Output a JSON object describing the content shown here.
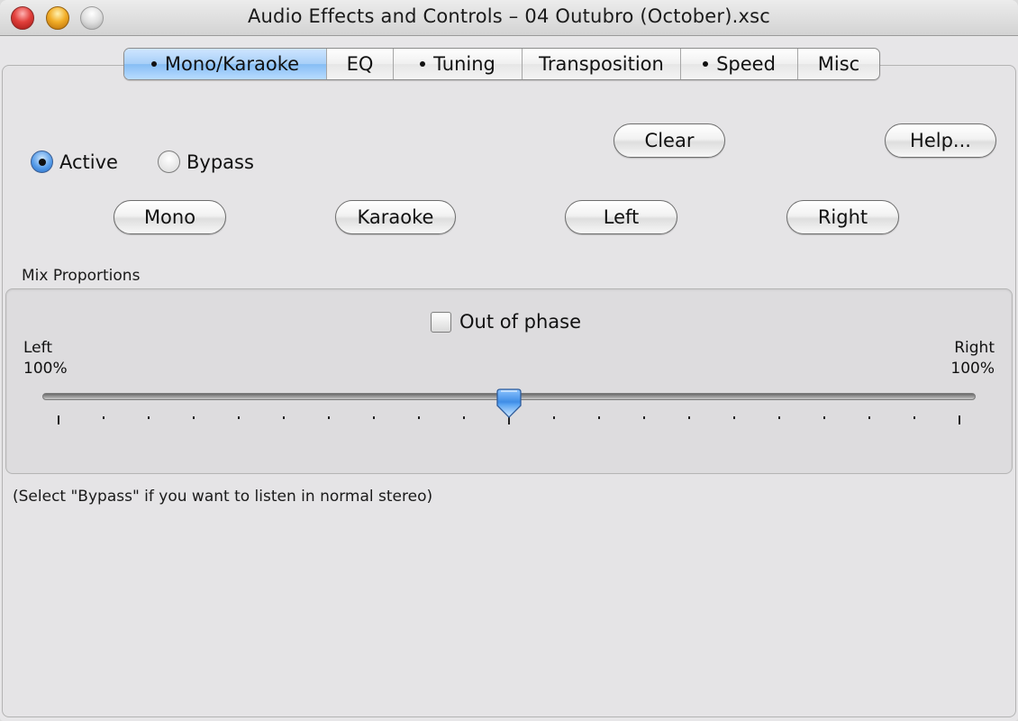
{
  "window": {
    "title": "Audio Effects and Controls – 04 Outubro (October).xsc",
    "controls": [
      "close",
      "minimize",
      "zoom"
    ]
  },
  "tabs": [
    {
      "label": "Mono/Karaoke",
      "dot": true,
      "selected": true
    },
    {
      "label": "EQ",
      "dot": false,
      "selected": false
    },
    {
      "label": "Tuning",
      "dot": true,
      "selected": false
    },
    {
      "label": "Transposition",
      "dot": false,
      "selected": false
    },
    {
      "label": "Speed",
      "dot": true,
      "selected": false
    },
    {
      "label": "Misc",
      "dot": false,
      "selected": false
    }
  ],
  "mode": {
    "options": [
      "Active",
      "Bypass"
    ],
    "selected": "Active"
  },
  "buttons": {
    "clear": "Clear",
    "help": "Help...",
    "mono": "Mono",
    "karaoke": "Karaoke",
    "left": "Left",
    "right": "Right"
  },
  "mix": {
    "group_label": "Mix Proportions",
    "out_of_phase_label": "Out of phase",
    "out_of_phase_checked": false,
    "left_label": "Left",
    "left_value": "100%",
    "right_label": "Right",
    "right_value": "100%",
    "slider_value_percent": 50,
    "tick_count": 21,
    "major_ticks": [
      0,
      10,
      20
    ]
  },
  "hint": "(Select \"Bypass\" if you want to listen in normal stereo)"
}
